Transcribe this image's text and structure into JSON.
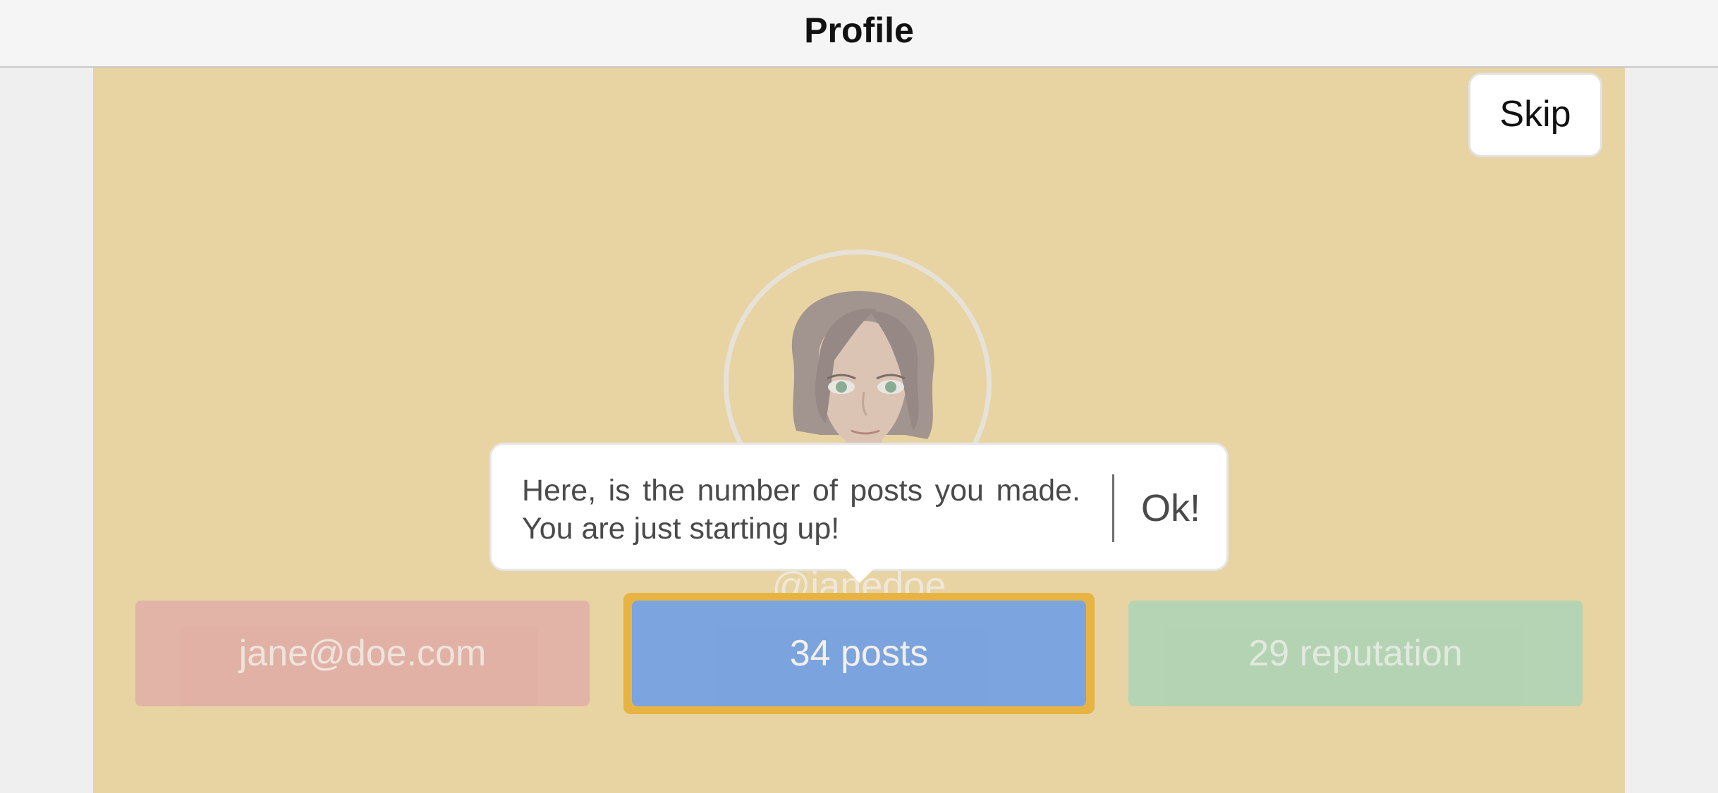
{
  "navbar": {
    "title": "Profile"
  },
  "onboarding": {
    "skip_label": "Skip",
    "tooltip_text": "Here, is the number of posts you made. You are just starting up!",
    "ok_label": "Ok!"
  },
  "profile": {
    "username": "@janedoe",
    "email": "jane@doe.com",
    "posts": "34 posts",
    "reputation": "29 reputation"
  },
  "colors": {
    "background": "#f3dca8",
    "email_tile": "#ebb7ae",
    "posts_tile": "#79a9f1",
    "reputation_tile": "#b9dcbc",
    "highlight": "#f2bb45"
  }
}
